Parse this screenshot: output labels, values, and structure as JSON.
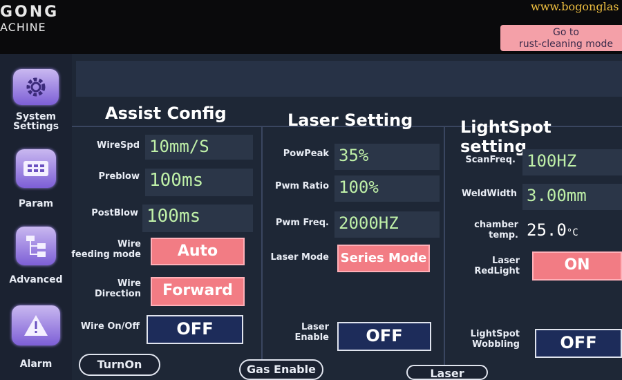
{
  "brand": {
    "logo_line1": "GONG",
    "logo_line2": "ACHINE",
    "website": "www.bogonglas"
  },
  "sidebar": {
    "items": [
      {
        "label": "System\nSettings",
        "icon": "gear-icon"
      },
      {
        "label": "Param",
        "icon": "keypad-icon"
      },
      {
        "label": "Advanced",
        "icon": "tree-icon"
      },
      {
        "label": "Alarm",
        "icon": "warning-icon"
      }
    ]
  },
  "header": {
    "goto_label": "Go to\nrust-cleaning mode"
  },
  "assist": {
    "title": "Assist Config",
    "wirespd_label": "WireSpd",
    "wirespd_value": "10mm/S",
    "preblow_label": "Preblow",
    "preblow_value": "100ms",
    "postblow_label": "PostBlow",
    "postblow_value": "100ms",
    "feeding_label": "Wire\nfeeding mode",
    "feeding_value": "Auto",
    "direction_label": "Wire\nDirection",
    "direction_value": "Forward",
    "onoff_label": "Wire On/Off",
    "onoff_value": "OFF"
  },
  "laser": {
    "title": "Laser Setting",
    "powpeak_label": "PowPeak",
    "powpeak_value": "35%",
    "pwmratio_label": "Pwm Ratio",
    "pwmratio_value": "100%",
    "pwmfreq_label": "Pwm Freq.",
    "pwmfreq_value": "2000HZ",
    "mode_label": "Laser Mode",
    "mode_value": "Series Mode",
    "enable_label": "Laser\nEnable",
    "enable_value": "OFF"
  },
  "lightspot": {
    "title": "LightSpot setting",
    "scanfreq_label": "ScanFreq.",
    "scanfreq_value": "100HZ",
    "weldwidth_label": "WeldWidth",
    "weldwidth_value": "3.00mm",
    "chamber_label": "chamber\ntemp.",
    "chamber_value": "25.0",
    "chamber_unit": "°C",
    "redlight_label": "Laser\nRedLight",
    "redlight_value": "ON",
    "wobbling_label": "LightSpot\nWobbling",
    "wobbling_value": "OFF"
  },
  "bottom": {
    "turnon": "TurnOn",
    "gas_enable": "Gas Enable",
    "laser": "Laser"
  }
}
